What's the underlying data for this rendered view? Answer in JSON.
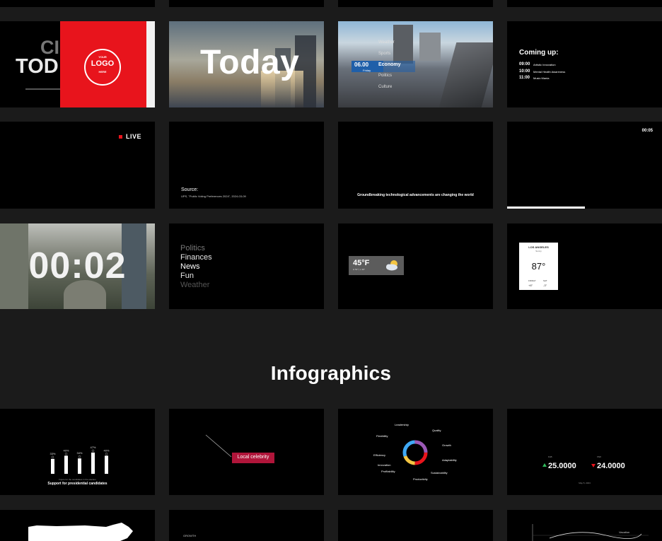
{
  "tiles": {
    "logo": {
      "bg_text_top": "CI",
      "bg_text_bottom": "TOD",
      "logo_top": "YOUR",
      "logo_main": "LOGO",
      "logo_bottom": "HERE",
      "accent": "#e8141c"
    },
    "today": {
      "title": "Today"
    },
    "schedule_list": {
      "time": "06.00",
      "day": "Friday",
      "items": [
        "Weather",
        "Sports",
        "Economy",
        "Politics",
        "Culture"
      ],
      "active": "Economy"
    },
    "coming_up": {
      "title": "Coming up:",
      "rows": [
        {
          "time": "09:00",
          "label": "Artistic Innovation"
        },
        {
          "time": "10:00",
          "label": "Mental Health Awareness"
        },
        {
          "time": "11:00",
          "label": "Music Mania"
        }
      ]
    },
    "live": {
      "label": "LIVE",
      "dot_color": "#e8141c"
    },
    "source": {
      "label": "Source:",
      "detail": "UPS, \"Public Voting Preferences 2024\", 2024-03-09"
    },
    "headline": {
      "text": "Groundbreaking technological advancements are changing the world"
    },
    "progress": {
      "time": "00:05",
      "progress": 0.5
    },
    "countdown": {
      "value": "00:02"
    },
    "menu": {
      "items": [
        "Politics",
        "Finances",
        "News",
        "Fun",
        "Weather"
      ]
    },
    "weather_small": {
      "temp": "45°F",
      "detail": "H 52° | L 38°",
      "icon": "partly-cloudy-icon"
    },
    "weather_card": {
      "city": "LOS ANGELES",
      "condition": "Sunny",
      "temp": "87°",
      "left_day": "FRIDAY",
      "left_temp": "+8°",
      "right_day": "SAT",
      "right_temp": "-3°"
    }
  },
  "section": {
    "title": "Infographics"
  },
  "infographics": {
    "bar_chart": {
      "caption": "Support for presidential candidates",
      "subcaption": "Figure for the candidates in the election",
      "chart_data": {
        "type": "bar",
        "categories": [
          "",
          "",
          "",
          "",
          ""
        ],
        "values": [
          33,
          40,
          34,
          47,
          40
        ],
        "labels": [
          "33%",
          "40%",
          "34%",
          "47%",
          "40%"
        ]
      }
    },
    "callout": {
      "label": "Local celebrity",
      "accent": "#b0153a"
    },
    "donut": {
      "labels": [
        "Leadership",
        "Quality",
        "Growth",
        "Adaptability",
        "Sustainability",
        "Productivity",
        "Profitability",
        "Innovation",
        "Efficiency",
        "Flexibility"
      ]
    },
    "stocks": {
      "left_label": "FLB",
      "left_value": "25.0000",
      "left_color": "#2fb85a",
      "right_label": "VSX",
      "right_value": "24.0000",
      "right_color": "#e8141c",
      "date": "May 5, 2024"
    },
    "row5": {
      "growth_label": "GROWTH",
      "chart_label": "Vacation"
    }
  }
}
